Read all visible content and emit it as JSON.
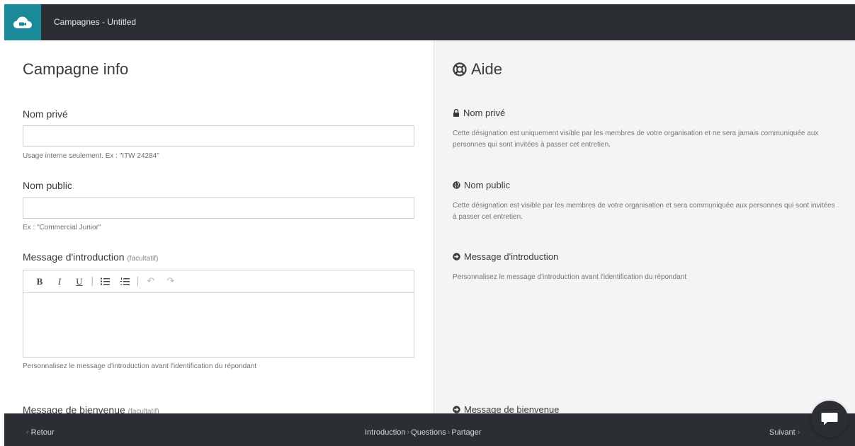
{
  "header": {
    "title": "Campagnes - Untitled",
    "logo_icon": "cloud-camera-icon"
  },
  "form": {
    "title": "Campagne info",
    "private_name": {
      "label": "Nom privé",
      "value": "",
      "help": "Usage interne seulement. Ex : \"ITW 24284\""
    },
    "public_name": {
      "label": "Nom public",
      "value": "",
      "help": "Ex : \"Commercial Junior\""
    },
    "intro_message": {
      "label": "Message d'introduction",
      "optional": "(facultatif)",
      "help": "Personnalisez le message d'introduction avant l'identification du répondant",
      "toolbar": {
        "bold": "B",
        "italic": "I",
        "underline": "U",
        "separator": "|",
        "bullet_list_icon": "bullet-list-icon",
        "numbered_list_icon": "numbered-list-icon",
        "undo_icon": "undo-icon",
        "redo_icon": "redo-icon"
      }
    },
    "welcome_message": {
      "label": "Message de bienvenue",
      "optional": "(facultatif)"
    }
  },
  "help": {
    "title": "Aide",
    "title_icon": "lifebuoy-icon",
    "sections": [
      {
        "icon": "lock-icon",
        "title": "Nom privé",
        "text": "Cette désignation est uniquement visible par les membres de votre organisation et ne sera jamais communiquée aux personnes qui sont invitées à passer cet entretien."
      },
      {
        "icon": "globe-icon",
        "title": "Nom public",
        "text": "Cette désignation est visible par les membres de votre organisation et sera communiquée aux personnes qui sont invitées à passer cet entretien."
      },
      {
        "icon": "arrow-circle-right-icon",
        "title": "Message d'introduction",
        "text": "Personnalisez le message d'introduction avant l'identification du répondant"
      },
      {
        "icon": "arrow-circle-right-icon",
        "title": "Message de bienvenue"
      }
    ]
  },
  "footer": {
    "back": "Retour",
    "next": "Suivant",
    "steps": [
      "Introduction",
      "Questions",
      "Partager"
    ],
    "step_separator": "›",
    "chat_icon": "chat-bubble-icon"
  },
  "colors": {
    "topbar": "#2b2e33",
    "brand": "#1a8a9a",
    "help_background": "#f4f4f4"
  }
}
